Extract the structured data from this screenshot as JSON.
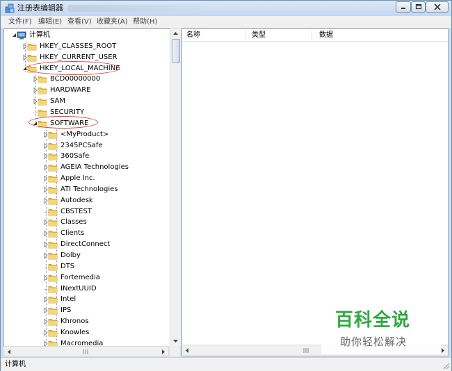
{
  "window": {
    "title": "注册表编辑器"
  },
  "menu": [
    "文件(F)",
    "编辑(E)",
    "查看(V)",
    "收藏夹(A)",
    "帮助(H)"
  ],
  "tree": {
    "root": "计算机",
    "hives": [
      "HKEY_CLASSES_ROOT",
      "HKEY_CURRENT_USER",
      "HKEY_LOCAL_MACHINE"
    ],
    "hklm_children": [
      "BCD00000000",
      "HARDWARE",
      "SAM",
      "SECURITY",
      "SOFTWARE"
    ],
    "software_children": [
      "<MyProduct>",
      "2345PCSafe",
      "360Safe",
      "AGEIA Technologies",
      "Apple Inc.",
      "ATI Technologies",
      "Autodesk",
      "CBSTEST",
      "Classes",
      "Clients",
      "DirectConnect",
      "Dolby",
      "DTS",
      "Fortemedia",
      "INextUUID",
      "Intel",
      "IPS",
      "Khronos",
      "Knowles",
      "Macromedia"
    ]
  },
  "list_columns": [
    "名称",
    "类型",
    "数据"
  ],
  "status": "计算机",
  "watermark": {
    "title": "百科全说",
    "subtitle": "助你轻松解决"
  },
  "colors": {
    "annotation": "#e04040",
    "watermark_green": "#2fa840",
    "folder": "#e8c14c"
  }
}
